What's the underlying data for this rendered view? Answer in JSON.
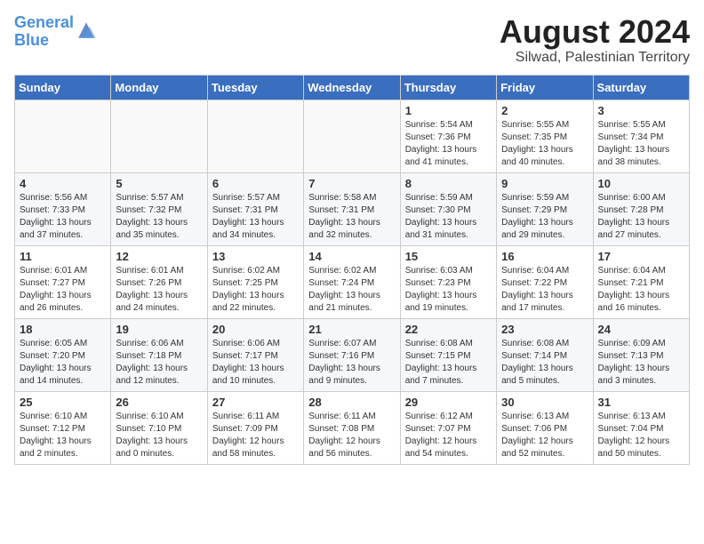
{
  "header": {
    "logo_line1": "General",
    "logo_line2": "Blue",
    "title": "August 2024",
    "subtitle": "Silwad, Palestinian Territory"
  },
  "weekdays": [
    "Sunday",
    "Monday",
    "Tuesday",
    "Wednesday",
    "Thursday",
    "Friday",
    "Saturday"
  ],
  "weeks": [
    [
      {
        "day": "",
        "info": ""
      },
      {
        "day": "",
        "info": ""
      },
      {
        "day": "",
        "info": ""
      },
      {
        "day": "",
        "info": ""
      },
      {
        "day": "1",
        "info": "Sunrise: 5:54 AM\nSunset: 7:36 PM\nDaylight: 13 hours\nand 41 minutes."
      },
      {
        "day": "2",
        "info": "Sunrise: 5:55 AM\nSunset: 7:35 PM\nDaylight: 13 hours\nand 40 minutes."
      },
      {
        "day": "3",
        "info": "Sunrise: 5:55 AM\nSunset: 7:34 PM\nDaylight: 13 hours\nand 38 minutes."
      }
    ],
    [
      {
        "day": "4",
        "info": "Sunrise: 5:56 AM\nSunset: 7:33 PM\nDaylight: 13 hours\nand 37 minutes."
      },
      {
        "day": "5",
        "info": "Sunrise: 5:57 AM\nSunset: 7:32 PM\nDaylight: 13 hours\nand 35 minutes."
      },
      {
        "day": "6",
        "info": "Sunrise: 5:57 AM\nSunset: 7:31 PM\nDaylight: 13 hours\nand 34 minutes."
      },
      {
        "day": "7",
        "info": "Sunrise: 5:58 AM\nSunset: 7:31 PM\nDaylight: 13 hours\nand 32 minutes."
      },
      {
        "day": "8",
        "info": "Sunrise: 5:59 AM\nSunset: 7:30 PM\nDaylight: 13 hours\nand 31 minutes."
      },
      {
        "day": "9",
        "info": "Sunrise: 5:59 AM\nSunset: 7:29 PM\nDaylight: 13 hours\nand 29 minutes."
      },
      {
        "day": "10",
        "info": "Sunrise: 6:00 AM\nSunset: 7:28 PM\nDaylight: 13 hours\nand 27 minutes."
      }
    ],
    [
      {
        "day": "11",
        "info": "Sunrise: 6:01 AM\nSunset: 7:27 PM\nDaylight: 13 hours\nand 26 minutes."
      },
      {
        "day": "12",
        "info": "Sunrise: 6:01 AM\nSunset: 7:26 PM\nDaylight: 13 hours\nand 24 minutes."
      },
      {
        "day": "13",
        "info": "Sunrise: 6:02 AM\nSunset: 7:25 PM\nDaylight: 13 hours\nand 22 minutes."
      },
      {
        "day": "14",
        "info": "Sunrise: 6:02 AM\nSunset: 7:24 PM\nDaylight: 13 hours\nand 21 minutes."
      },
      {
        "day": "15",
        "info": "Sunrise: 6:03 AM\nSunset: 7:23 PM\nDaylight: 13 hours\nand 19 minutes."
      },
      {
        "day": "16",
        "info": "Sunrise: 6:04 AM\nSunset: 7:22 PM\nDaylight: 13 hours\nand 17 minutes."
      },
      {
        "day": "17",
        "info": "Sunrise: 6:04 AM\nSunset: 7:21 PM\nDaylight: 13 hours\nand 16 minutes."
      }
    ],
    [
      {
        "day": "18",
        "info": "Sunrise: 6:05 AM\nSunset: 7:20 PM\nDaylight: 13 hours\nand 14 minutes."
      },
      {
        "day": "19",
        "info": "Sunrise: 6:06 AM\nSunset: 7:18 PM\nDaylight: 13 hours\nand 12 minutes."
      },
      {
        "day": "20",
        "info": "Sunrise: 6:06 AM\nSunset: 7:17 PM\nDaylight: 13 hours\nand 10 minutes."
      },
      {
        "day": "21",
        "info": "Sunrise: 6:07 AM\nSunset: 7:16 PM\nDaylight: 13 hours\nand 9 minutes."
      },
      {
        "day": "22",
        "info": "Sunrise: 6:08 AM\nSunset: 7:15 PM\nDaylight: 13 hours\nand 7 minutes."
      },
      {
        "day": "23",
        "info": "Sunrise: 6:08 AM\nSunset: 7:14 PM\nDaylight: 13 hours\nand 5 minutes."
      },
      {
        "day": "24",
        "info": "Sunrise: 6:09 AM\nSunset: 7:13 PM\nDaylight: 13 hours\nand 3 minutes."
      }
    ],
    [
      {
        "day": "25",
        "info": "Sunrise: 6:10 AM\nSunset: 7:12 PM\nDaylight: 13 hours\nand 2 minutes."
      },
      {
        "day": "26",
        "info": "Sunrise: 6:10 AM\nSunset: 7:10 PM\nDaylight: 13 hours\nand 0 minutes."
      },
      {
        "day": "27",
        "info": "Sunrise: 6:11 AM\nSunset: 7:09 PM\nDaylight: 12 hours\nand 58 minutes."
      },
      {
        "day": "28",
        "info": "Sunrise: 6:11 AM\nSunset: 7:08 PM\nDaylight: 12 hours\nand 56 minutes."
      },
      {
        "day": "29",
        "info": "Sunrise: 6:12 AM\nSunset: 7:07 PM\nDaylight: 12 hours\nand 54 minutes."
      },
      {
        "day": "30",
        "info": "Sunrise: 6:13 AM\nSunset: 7:06 PM\nDaylight: 12 hours\nand 52 minutes."
      },
      {
        "day": "31",
        "info": "Sunrise: 6:13 AM\nSunset: 7:04 PM\nDaylight: 12 hours\nand 50 minutes."
      }
    ]
  ]
}
